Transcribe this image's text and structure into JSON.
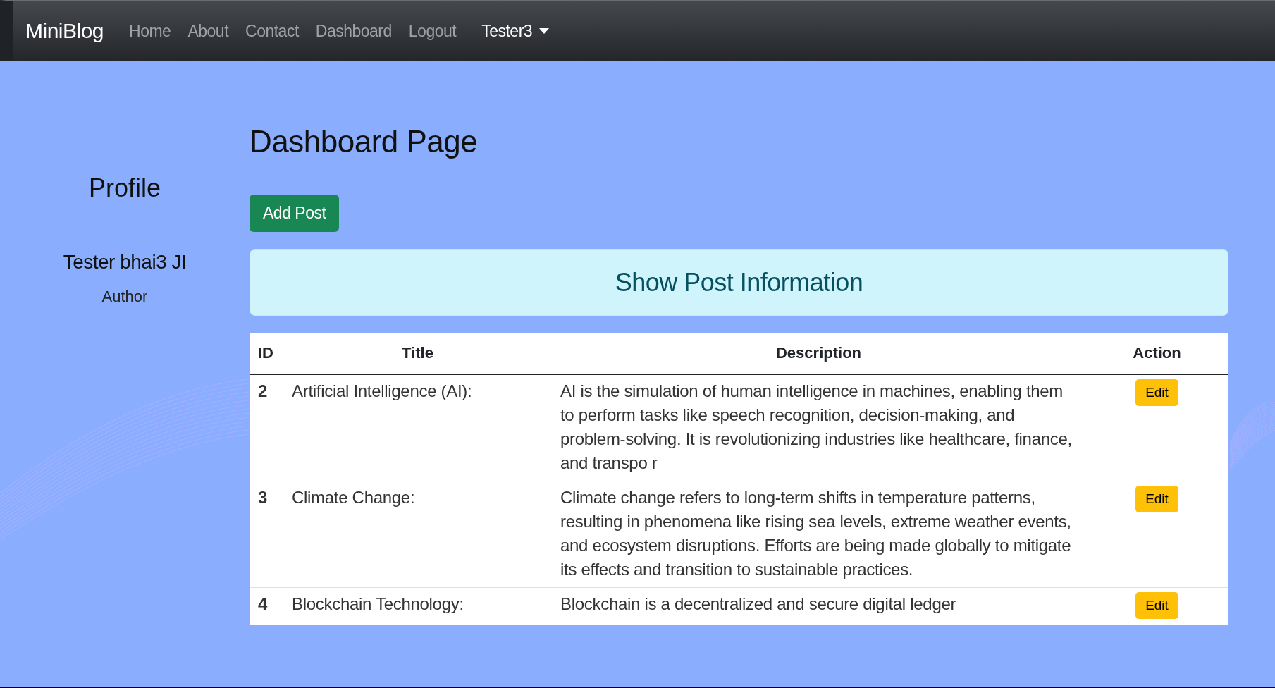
{
  "navbar": {
    "brand": "MiniBlog",
    "links": [
      {
        "label": "Home",
        "selected": false
      },
      {
        "label": "About",
        "selected": false
      },
      {
        "label": "Contact",
        "selected": false
      },
      {
        "label": "Dashboard",
        "selected": false
      },
      {
        "label": "Logout",
        "selected": false
      }
    ],
    "user_menu": {
      "label": "Tester3",
      "expanded": false
    }
  },
  "profile": {
    "heading": "Profile",
    "name": "Tester bhai3 JI",
    "role": "Author"
  },
  "main": {
    "title": "Dashboard Page",
    "add_button": "Add Post",
    "banner": "Show Post Information"
  },
  "table": {
    "columns": [
      "ID",
      "Title",
      "Description",
      "Action"
    ],
    "rows": [
      {
        "id": "2",
        "title": "Artificial Intelligence (AI):",
        "description": "AI is the simulation of human intelligence in machines, enabling them to perform tasks like speech recognition, decision-making, and problem-solving. It is revolutionizing industries like healthcare, finance, and transpo r",
        "action": "Edit"
      },
      {
        "id": "3",
        "title": "Climate Change:",
        "description": "Climate change refers to long-term shifts in temperature patterns, resulting in phenomena like rising sea levels, extreme weather events, and ecosystem disruptions. Efforts are being made globally to mitigate its effects and transition to sustainable practices.",
        "action": "Edit"
      },
      {
        "id": "4",
        "title": "Blockchain Technology:",
        "description": "Blockchain is a decentralized and secure digital ledger",
        "action": "Edit"
      }
    ]
  }
}
